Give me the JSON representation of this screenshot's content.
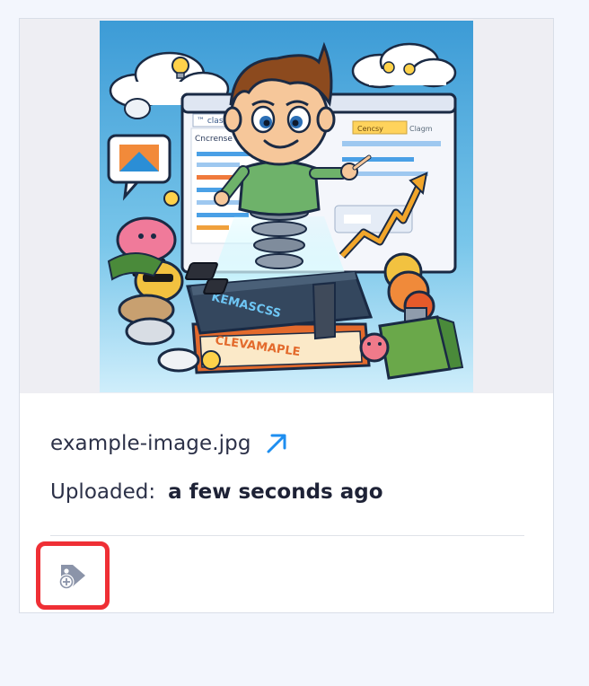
{
  "card": {
    "filename": "example-image.jpg",
    "uploaded_label": "Uploaded:",
    "uploaded_value": "a few seconds ago"
  },
  "icons": {
    "external_link": "external-link-arrow-icon",
    "add_tag": "tag-add-icon"
  },
  "colors": {
    "page_background": "#f3f6fd",
    "link_accent": "#1e8ef0",
    "highlight_border": "#ef2f35",
    "tag_icon": "#8b94a9"
  },
  "illustration": {
    "browser_tab_left": "™ class",
    "browser_heading": "Cncrense",
    "browser_tab_right": "Cencsy",
    "browser_tab_far_right": "Clagm",
    "book_top": "KEMASCSS",
    "book_bottom": "CLEVAMAPLE"
  }
}
